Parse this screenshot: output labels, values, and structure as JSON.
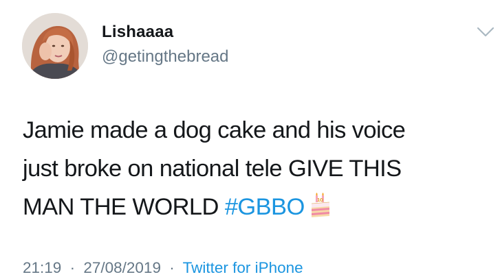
{
  "author": {
    "display_name": "Lishaaaa",
    "handle": "@getingthebread",
    "avatar_icon": "profile-photo"
  },
  "tweet": {
    "text_line_1": "Jamie made a dog cake and his voice",
    "text_line_2": "just broke on national tele GIVE THIS",
    "text_line_3": "MAN THE WORLD",
    "hashtag": "#GBBO",
    "emoji": "birthday-cake-emoji"
  },
  "meta": {
    "time": "21:19",
    "date": "27/08/2019",
    "separator": "·",
    "source": "Twitter for iPhone"
  },
  "colors": {
    "text": "#14171a",
    "secondary": "#657786",
    "link": "#1b95e0"
  },
  "menu": {
    "icon": "chevron-down-icon"
  }
}
